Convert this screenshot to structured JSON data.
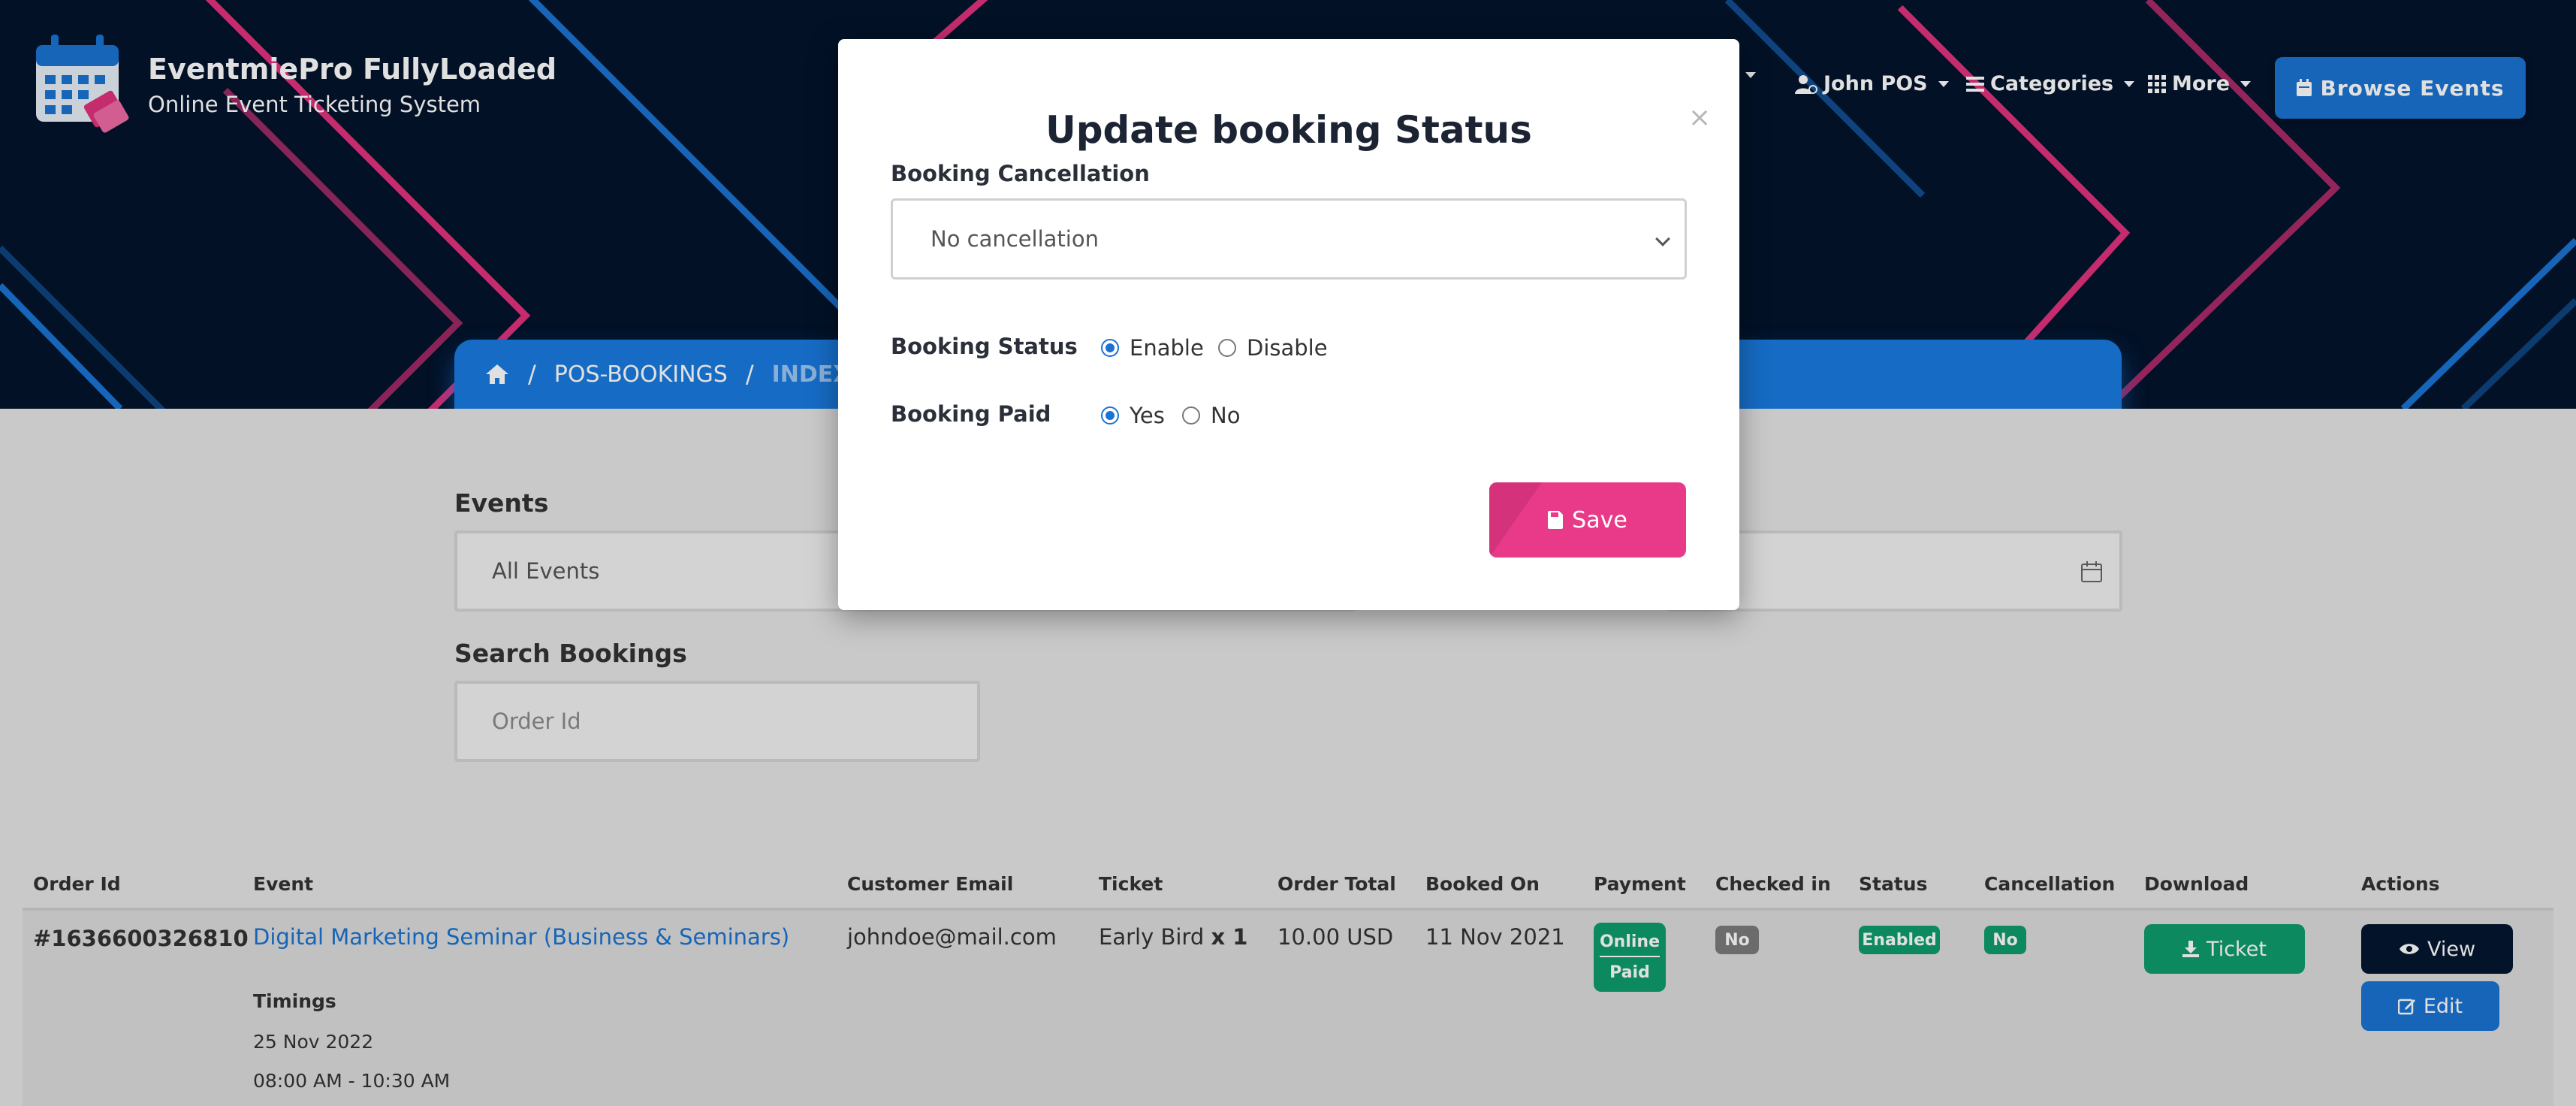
{
  "brand": {
    "title": "EventmiePro FullyLoaded",
    "subtitle": "Online Event Ticketing System"
  },
  "nav": {
    "user_label": "John POS",
    "categories_label": "Categories",
    "more_label": "More",
    "browse_label": "Browse Events"
  },
  "breadcrumb": {
    "items": [
      "POS-BOOKINGS",
      "INDEX"
    ],
    "separator": "/"
  },
  "filters": {
    "events_label": "Events",
    "events_value": "All Events",
    "search_label": "Search Bookings",
    "search_placeholder": "Order Id"
  },
  "table": {
    "headers": [
      "Order Id",
      "Event",
      "Customer Email",
      "Ticket",
      "Order Total",
      "Booked On",
      "Payment",
      "Checked in",
      "Status",
      "Cancellation",
      "Download",
      "Actions"
    ],
    "rows": [
      {
        "order_id": "#1636600326810",
        "event": "Digital Marketing Seminar (Business & Seminars)",
        "timings_label": "Timings",
        "date": "25 Nov 2022",
        "time": "08:00 AM - 10:30 AM",
        "email": "johndoe@mail.com",
        "ticket": "Early Bird",
        "qty": "x 1",
        "total": "10.00 USD",
        "booked_on": "11 Nov 2021",
        "payment_1": "Online",
        "payment_2": "Paid",
        "checked_in": "No",
        "status": "Enabled",
        "cancellation": "No",
        "download_label": "Ticket",
        "view_label": "View",
        "edit_label": "Edit"
      }
    ]
  },
  "modal": {
    "title": "Update booking Status",
    "close": "×",
    "cancellation_label": "Booking Cancellation",
    "cancellation_value": "No cancellation",
    "status_label": "Booking Status",
    "status_options": [
      "Enable",
      "Disable"
    ],
    "status_selected": "Enable",
    "paid_label": "Booking Paid",
    "paid_options": [
      "Yes",
      "No"
    ],
    "paid_selected": "Yes",
    "save_label": "Save"
  },
  "colors": {
    "primary": "#1a73d2",
    "accent_pink": "#e93a8a",
    "success": "#0f9d6e",
    "dark": "#03142c"
  }
}
